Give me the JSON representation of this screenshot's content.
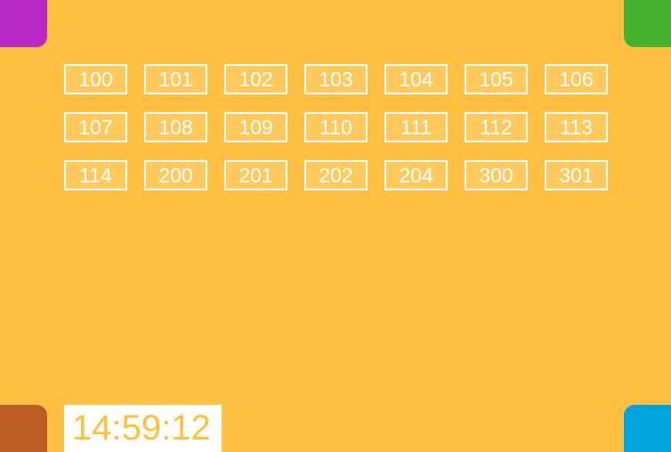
{
  "theme": {
    "background": "#FFBF40",
    "tile_border": "#FFFFFF",
    "tile_text": "#FFFFFF",
    "clock_background": "#FFFFFF",
    "clock_text": "#FFBF40"
  },
  "corners": {
    "top_left": {
      "color": "#B928C4"
    },
    "top_right": {
      "color": "#45B12E"
    },
    "bottom_left": {
      "color": "#BA5E24"
    },
    "bottom_right": {
      "color": "#00A5DF"
    }
  },
  "tiles": [
    "100",
    "101",
    "102",
    "103",
    "104",
    "105",
    "106",
    "107",
    "108",
    "109",
    "110",
    "111",
    "112",
    "113",
    "114",
    "200",
    "201",
    "202",
    "204",
    "300",
    "301"
  ],
  "clock": {
    "time": "14:59:12"
  }
}
